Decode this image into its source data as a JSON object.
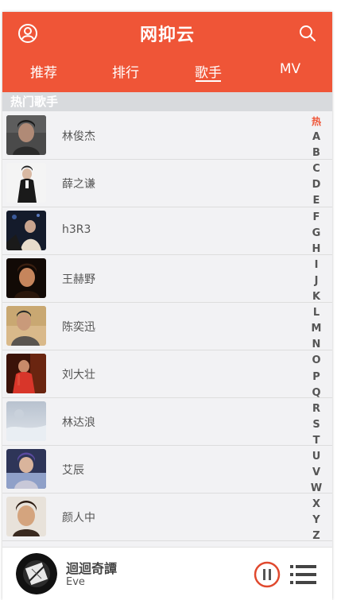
{
  "header": {
    "title": "网抑云",
    "left_icon": "user-icon",
    "right_icon": "search-icon",
    "color": "#ef5537"
  },
  "tabs": [
    {
      "label": "推荐",
      "active": false
    },
    {
      "label": "排行",
      "active": false
    },
    {
      "label": "歌手",
      "active": true
    },
    {
      "label": "MV",
      "active": false
    }
  ],
  "section": {
    "title": "热门歌手"
  },
  "artists": [
    {
      "name": "林俊杰"
    },
    {
      "name": "薛之谦"
    },
    {
      "name": "h3R3"
    },
    {
      "name": "王赫野"
    },
    {
      "name": "陈奕迅"
    },
    {
      "name": "刘大壮"
    },
    {
      "name": "林达浪"
    },
    {
      "name": "艾辰"
    },
    {
      "name": "颜人中"
    }
  ],
  "index_bar": [
    "热",
    "A",
    "B",
    "C",
    "D",
    "E",
    "F",
    "G",
    "H",
    "I",
    "J",
    "K",
    "L",
    "M",
    "N",
    "O",
    "P",
    "Q",
    "R",
    "S",
    "T",
    "U",
    "V",
    "W",
    "X",
    "Y",
    "Z"
  ],
  "player": {
    "song_title": "迴迴奇譚",
    "artist": "Eve",
    "play_icon": "pause-icon",
    "list_icon": "playlist-icon"
  }
}
